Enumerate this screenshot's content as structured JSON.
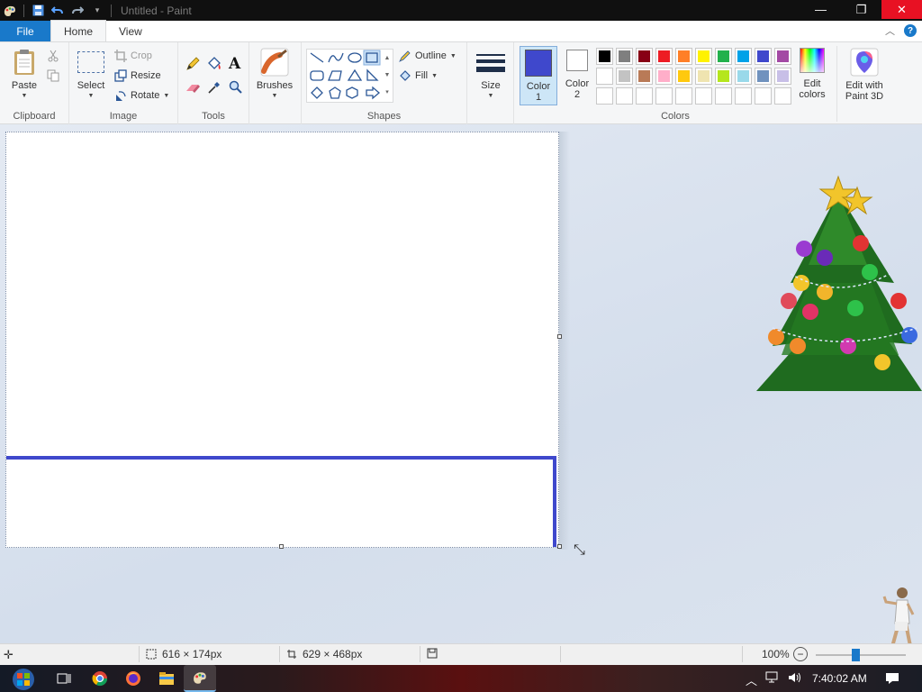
{
  "window": {
    "title": "Untitled - Paint",
    "minimize": "—",
    "maximize": "❐",
    "close": "✕"
  },
  "tabs": {
    "file": "File",
    "home": "Home",
    "view": "View"
  },
  "ribbon": {
    "clipboard": {
      "label": "Clipboard",
      "paste": "Paste"
    },
    "image": {
      "label": "Image",
      "select": "Select",
      "crop": "Crop",
      "resize": "Resize",
      "rotate": "Rotate"
    },
    "tools": {
      "label": "Tools"
    },
    "brushes": {
      "label": "Brushes"
    },
    "shapes": {
      "label": "Shapes",
      "outline": "Outline",
      "fill": "Fill"
    },
    "size": {
      "label": "Size"
    },
    "color1": {
      "line1": "Color",
      "line2": "1",
      "value": "#3f48cc"
    },
    "color2": {
      "line1": "Color",
      "line2": "2",
      "value": "#ffffff"
    },
    "colors": {
      "label": "Colors"
    },
    "edit_colors": {
      "line1": "Edit",
      "line2": "colors"
    },
    "paint3d": {
      "line1": "Edit with",
      "line2": "Paint 3D"
    }
  },
  "palette": {
    "row1": [
      "#000000",
      "#7f7f7f",
      "#880015",
      "#ed1c24",
      "#ff7f27",
      "#fff200",
      "#22b14c",
      "#00a2e8",
      "#3f48cc",
      "#a349a4"
    ],
    "row2": [
      "#ffffff",
      "#c3c3c3",
      "#b97a57",
      "#ffaec9",
      "#ffc90e",
      "#efe4b0",
      "#b5e61d",
      "#99d9ea",
      "#7092be",
      "#c8bfe7"
    ],
    "row3": [
      "",
      "",
      "",
      "",
      "",
      "",
      "",
      "",
      "",
      ""
    ]
  },
  "canvas": {
    "stroke_color": "#3f48cc"
  },
  "status": {
    "selection_size": "616 × 174px",
    "canvas_size": "629 × 468px",
    "zoom": "100%"
  },
  "taskbar": {
    "time": "7:40:02 AM"
  }
}
